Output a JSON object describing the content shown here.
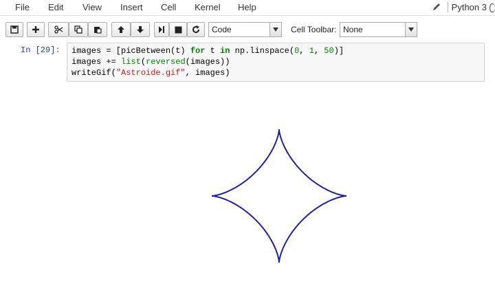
{
  "menubar": {
    "items": [
      "File",
      "Edit",
      "View",
      "Insert",
      "Cell",
      "Kernel",
      "Help"
    ],
    "kernel_name": "Python 3"
  },
  "toolbar": {
    "buttons": [
      "save-icon",
      "plus-icon",
      "scissors-icon",
      "copy-icon",
      "paste-icon",
      "arrow-up-icon",
      "arrow-down-icon",
      "step-icon",
      "stop-icon",
      "restart-icon"
    ],
    "cell_type": "Code",
    "cell_toolbar_label": "Cell Toolbar:",
    "cell_toolbar_value": "None"
  },
  "cell": {
    "prompt": "In [29]:",
    "code": [
      "images = [picBetween(t) for t in np.linspace(0, 1, 50)]",
      "images += list(reversed(images))",
      "writeGif(\"Astroide.gif\", images)"
    ]
  },
  "output": {
    "figure": "astroid curve",
    "stroke_color": "#1f1fa0"
  }
}
